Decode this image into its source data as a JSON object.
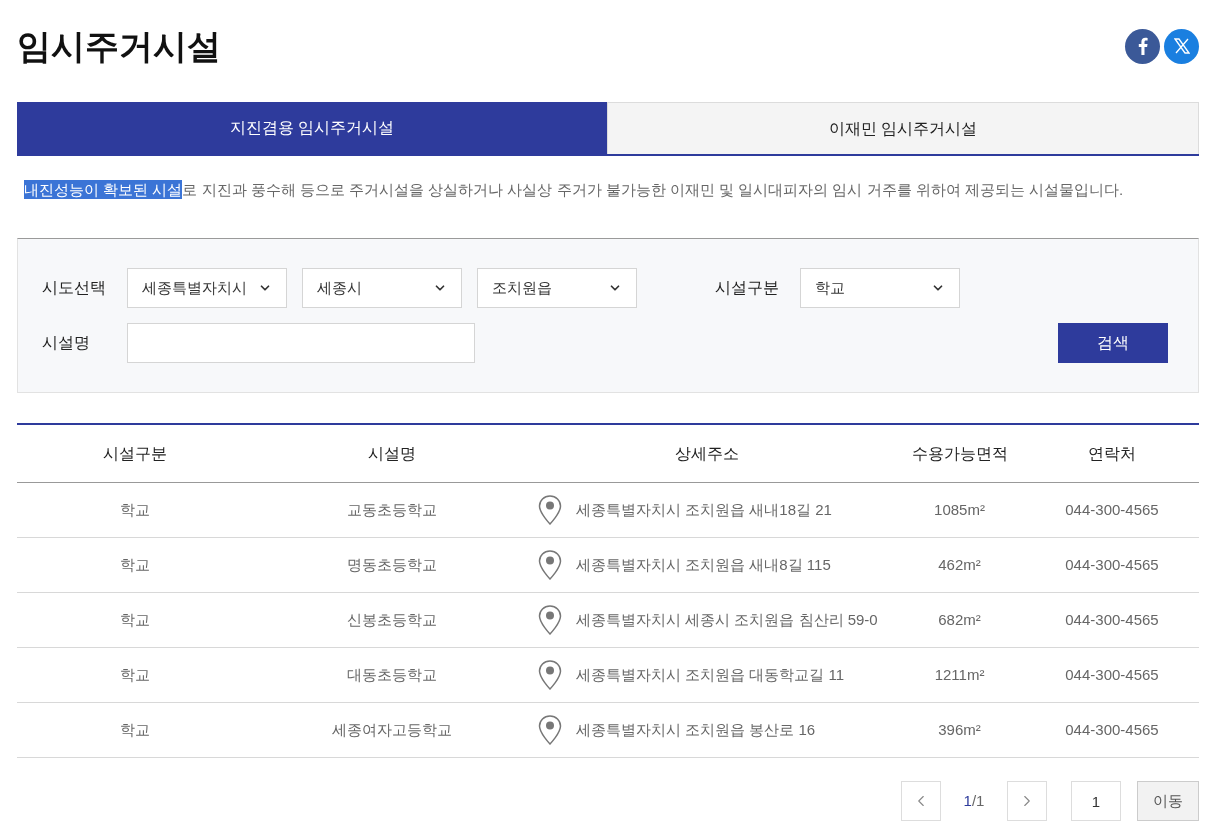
{
  "title": "임시주거시설",
  "share": [
    {
      "kind": "facebook"
    },
    {
      "kind": "x"
    }
  ],
  "tabs": [
    {
      "label": "지진겸용 임시주거시설",
      "selected": true
    },
    {
      "label": "이재민 임시주거시설",
      "selected": false
    }
  ],
  "description": [
    {
      "text": "내진성능이 확보된 시설",
      "selected": true
    },
    {
      "text": "로 지진과 풍수해 등으로 주거시설을 상실하거나 사실상 주거가 불가능한 이재민 및 일시대피자의 임시 거주를 위하여 제공되는 시설물입니다.",
      "selected": false
    }
  ],
  "filters": {
    "region_label": "시도선택",
    "region_selects": [
      "세종특별자치시",
      "세종시",
      "조치원읍"
    ],
    "type_label": "시설구분",
    "type_select": "학교",
    "name_label": "시설명",
    "search_button": "검색"
  },
  "table": {
    "columns": [
      "시설구분",
      "시설명",
      "상세주소",
      "수용가능면적",
      "연락처"
    ],
    "rows": [
      {
        "type": "학교",
        "name": "교동초등학교",
        "address": "세종특별자치시 조치원읍 새내18길 21",
        "area": "1085m²",
        "phone": "044-300-4565"
      },
      {
        "type": "학교",
        "name": "명동초등학교",
        "address": "세종특별자치시 조치원읍 새내8길 115",
        "area": "462m²",
        "phone": "044-300-4565"
      },
      {
        "type": "학교",
        "name": "신봉초등학교",
        "address": "세종특별자치시 세종시 조치원읍 침산리 59-0",
        "area": "682m²",
        "phone": "044-300-4565"
      },
      {
        "type": "학교",
        "name": "대동초등학교",
        "address": "세종특별자치시 조치원읍 대동학교길 11",
        "area": "1211m²",
        "phone": "044-300-4565"
      },
      {
        "type": "학교",
        "name": "세종여자고등학교",
        "address": "세종특별자치시 조치원읍 봉산로 16",
        "area": "396m²",
        "phone": "044-300-4565"
      }
    ]
  },
  "pagination": {
    "current": "1",
    "total": "/1",
    "page_input": "1",
    "go_button": "이동"
  }
}
